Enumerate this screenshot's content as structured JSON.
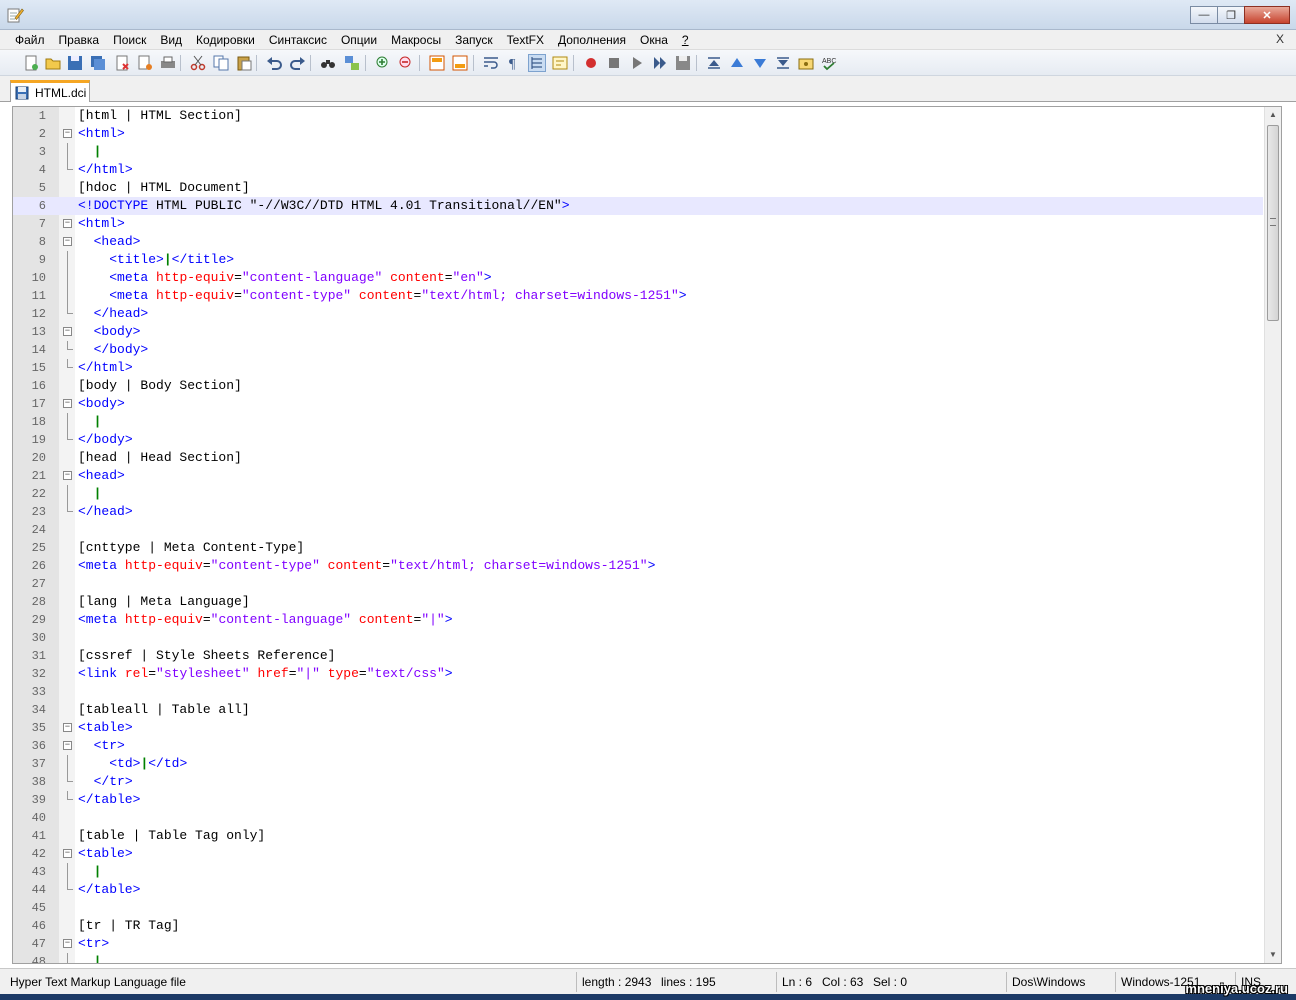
{
  "window": {
    "icon": "notepad-pencil-icon"
  },
  "menu": [
    "Файл",
    "Правка",
    "Поиск",
    "Вид",
    "Кодировки",
    "Синтаксис",
    "Опции",
    "Макросы",
    "Запуск",
    "TextFX",
    "Дополнения",
    "Окна",
    "?"
  ],
  "menu_close": "X",
  "tab": {
    "label": "HTML.dci"
  },
  "editor": {
    "current_line": 6,
    "lines": [
      {
        "n": "1",
        "code": "[html | HTML Section]"
      },
      {
        "n": "2",
        "code": "<html>"
      },
      {
        "n": "3",
        "code": "  |"
      },
      {
        "n": "4",
        "code": "</html>"
      },
      {
        "n": "5",
        "code": "[hdoc | HTML Document]"
      },
      {
        "n": "6",
        "code": "<!DOCTYPE HTML PUBLIC \"-//W3C//DTD HTML 4.01 Transitional//EN\">"
      },
      {
        "n": "7",
        "code": "<html>"
      },
      {
        "n": "8",
        "code": "  <head>"
      },
      {
        "n": "9",
        "code": "    <title>|</title>"
      },
      {
        "n": "10",
        "code": "    <meta http-equiv=\"content-language\" content=\"en\">"
      },
      {
        "n": "11",
        "code": "    <meta http-equiv=\"content-type\" content=\"text/html; charset=windows-1251\">"
      },
      {
        "n": "12",
        "code": "  </head>"
      },
      {
        "n": "13",
        "code": "  <body>"
      },
      {
        "n": "14",
        "code": "  </body>"
      },
      {
        "n": "15",
        "code": "</html>"
      },
      {
        "n": "16",
        "code": "[body | Body Section]"
      },
      {
        "n": "17",
        "code": "<body>"
      },
      {
        "n": "18",
        "code": "  |"
      },
      {
        "n": "19",
        "code": "</body>"
      },
      {
        "n": "20",
        "code": "[head | Head Section]"
      },
      {
        "n": "21",
        "code": "<head>"
      },
      {
        "n": "22",
        "code": "  |"
      },
      {
        "n": "23",
        "code": "</head>"
      },
      {
        "n": "24",
        "code": ""
      },
      {
        "n": "25",
        "code": "[cnttype | Meta Content-Type]"
      },
      {
        "n": "26",
        "code": "<meta http-equiv=\"content-type\" content=\"text/html; charset=windows-1251\">"
      },
      {
        "n": "27",
        "code": ""
      },
      {
        "n": "28",
        "code": "[lang | Meta Language]"
      },
      {
        "n": "29",
        "code": "<meta http-equiv=\"content-language\" content=\"|\">"
      },
      {
        "n": "30",
        "code": ""
      },
      {
        "n": "31",
        "code": "[cssref | Style Sheets Reference]"
      },
      {
        "n": "32",
        "code": "<link rel=\"stylesheet\" href=\"|\" type=\"text/css\">"
      },
      {
        "n": "33",
        "code": ""
      },
      {
        "n": "34",
        "code": "[tableall | Table all]"
      },
      {
        "n": "35",
        "code": "<table>"
      },
      {
        "n": "36",
        "code": "  <tr>"
      },
      {
        "n": "37",
        "code": "    <td>|</td>"
      },
      {
        "n": "38",
        "code": "  </tr>"
      },
      {
        "n": "39",
        "code": "</table>"
      },
      {
        "n": "40",
        "code": ""
      },
      {
        "n": "41",
        "code": "[table | Table Tag only]"
      },
      {
        "n": "42",
        "code": "<table>"
      },
      {
        "n": "43",
        "code": "  |"
      },
      {
        "n": "44",
        "code": "</table>"
      },
      {
        "n": "45",
        "code": ""
      },
      {
        "n": "46",
        "code": "[tr | TR Tag]"
      },
      {
        "n": "47",
        "code": "<tr>"
      },
      {
        "n": "48",
        "code": "  |"
      }
    ]
  },
  "status": {
    "file_type": "Hyper Text Markup Language file",
    "length": "length : 2943",
    "lines": "lines : 195",
    "ln": "Ln : 6",
    "col": "Col : 63",
    "sel": "Sel : 0",
    "eol": "Dos\\Windows",
    "encoding": "Windows-1251",
    "mode": "INS"
  },
  "watermark": "mneniya.ucoz.ru",
  "colors": {
    "tag": "#0000ff",
    "attr": "#ff0000",
    "value": "#8000ff",
    "tab_accent": "#f5a623",
    "current_line": "#e8e8ff"
  }
}
